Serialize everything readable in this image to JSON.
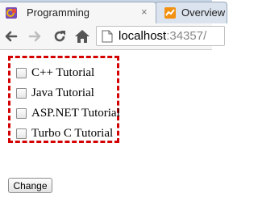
{
  "browser": {
    "tabs": [
      {
        "title": "Programming",
        "active": true,
        "close_symbol": "×"
      },
      {
        "title": "Overview",
        "active": false
      }
    ],
    "address_bar": {
      "host": "localhost",
      "port": ":34357/"
    }
  },
  "page": {
    "checkboxes": [
      {
        "label": "C++ Tutorial",
        "checked": false
      },
      {
        "label": "Java Tutorial",
        "checked": false
      },
      {
        "label": "ASP.NET Tutorial",
        "checked": false
      },
      {
        "label": "Turbo C Tutorial",
        "checked": false
      }
    ],
    "change_button_label": "Change"
  },
  "colors": {
    "selection_border": "#d40000",
    "tab_strip": "#c8d5e6"
  }
}
